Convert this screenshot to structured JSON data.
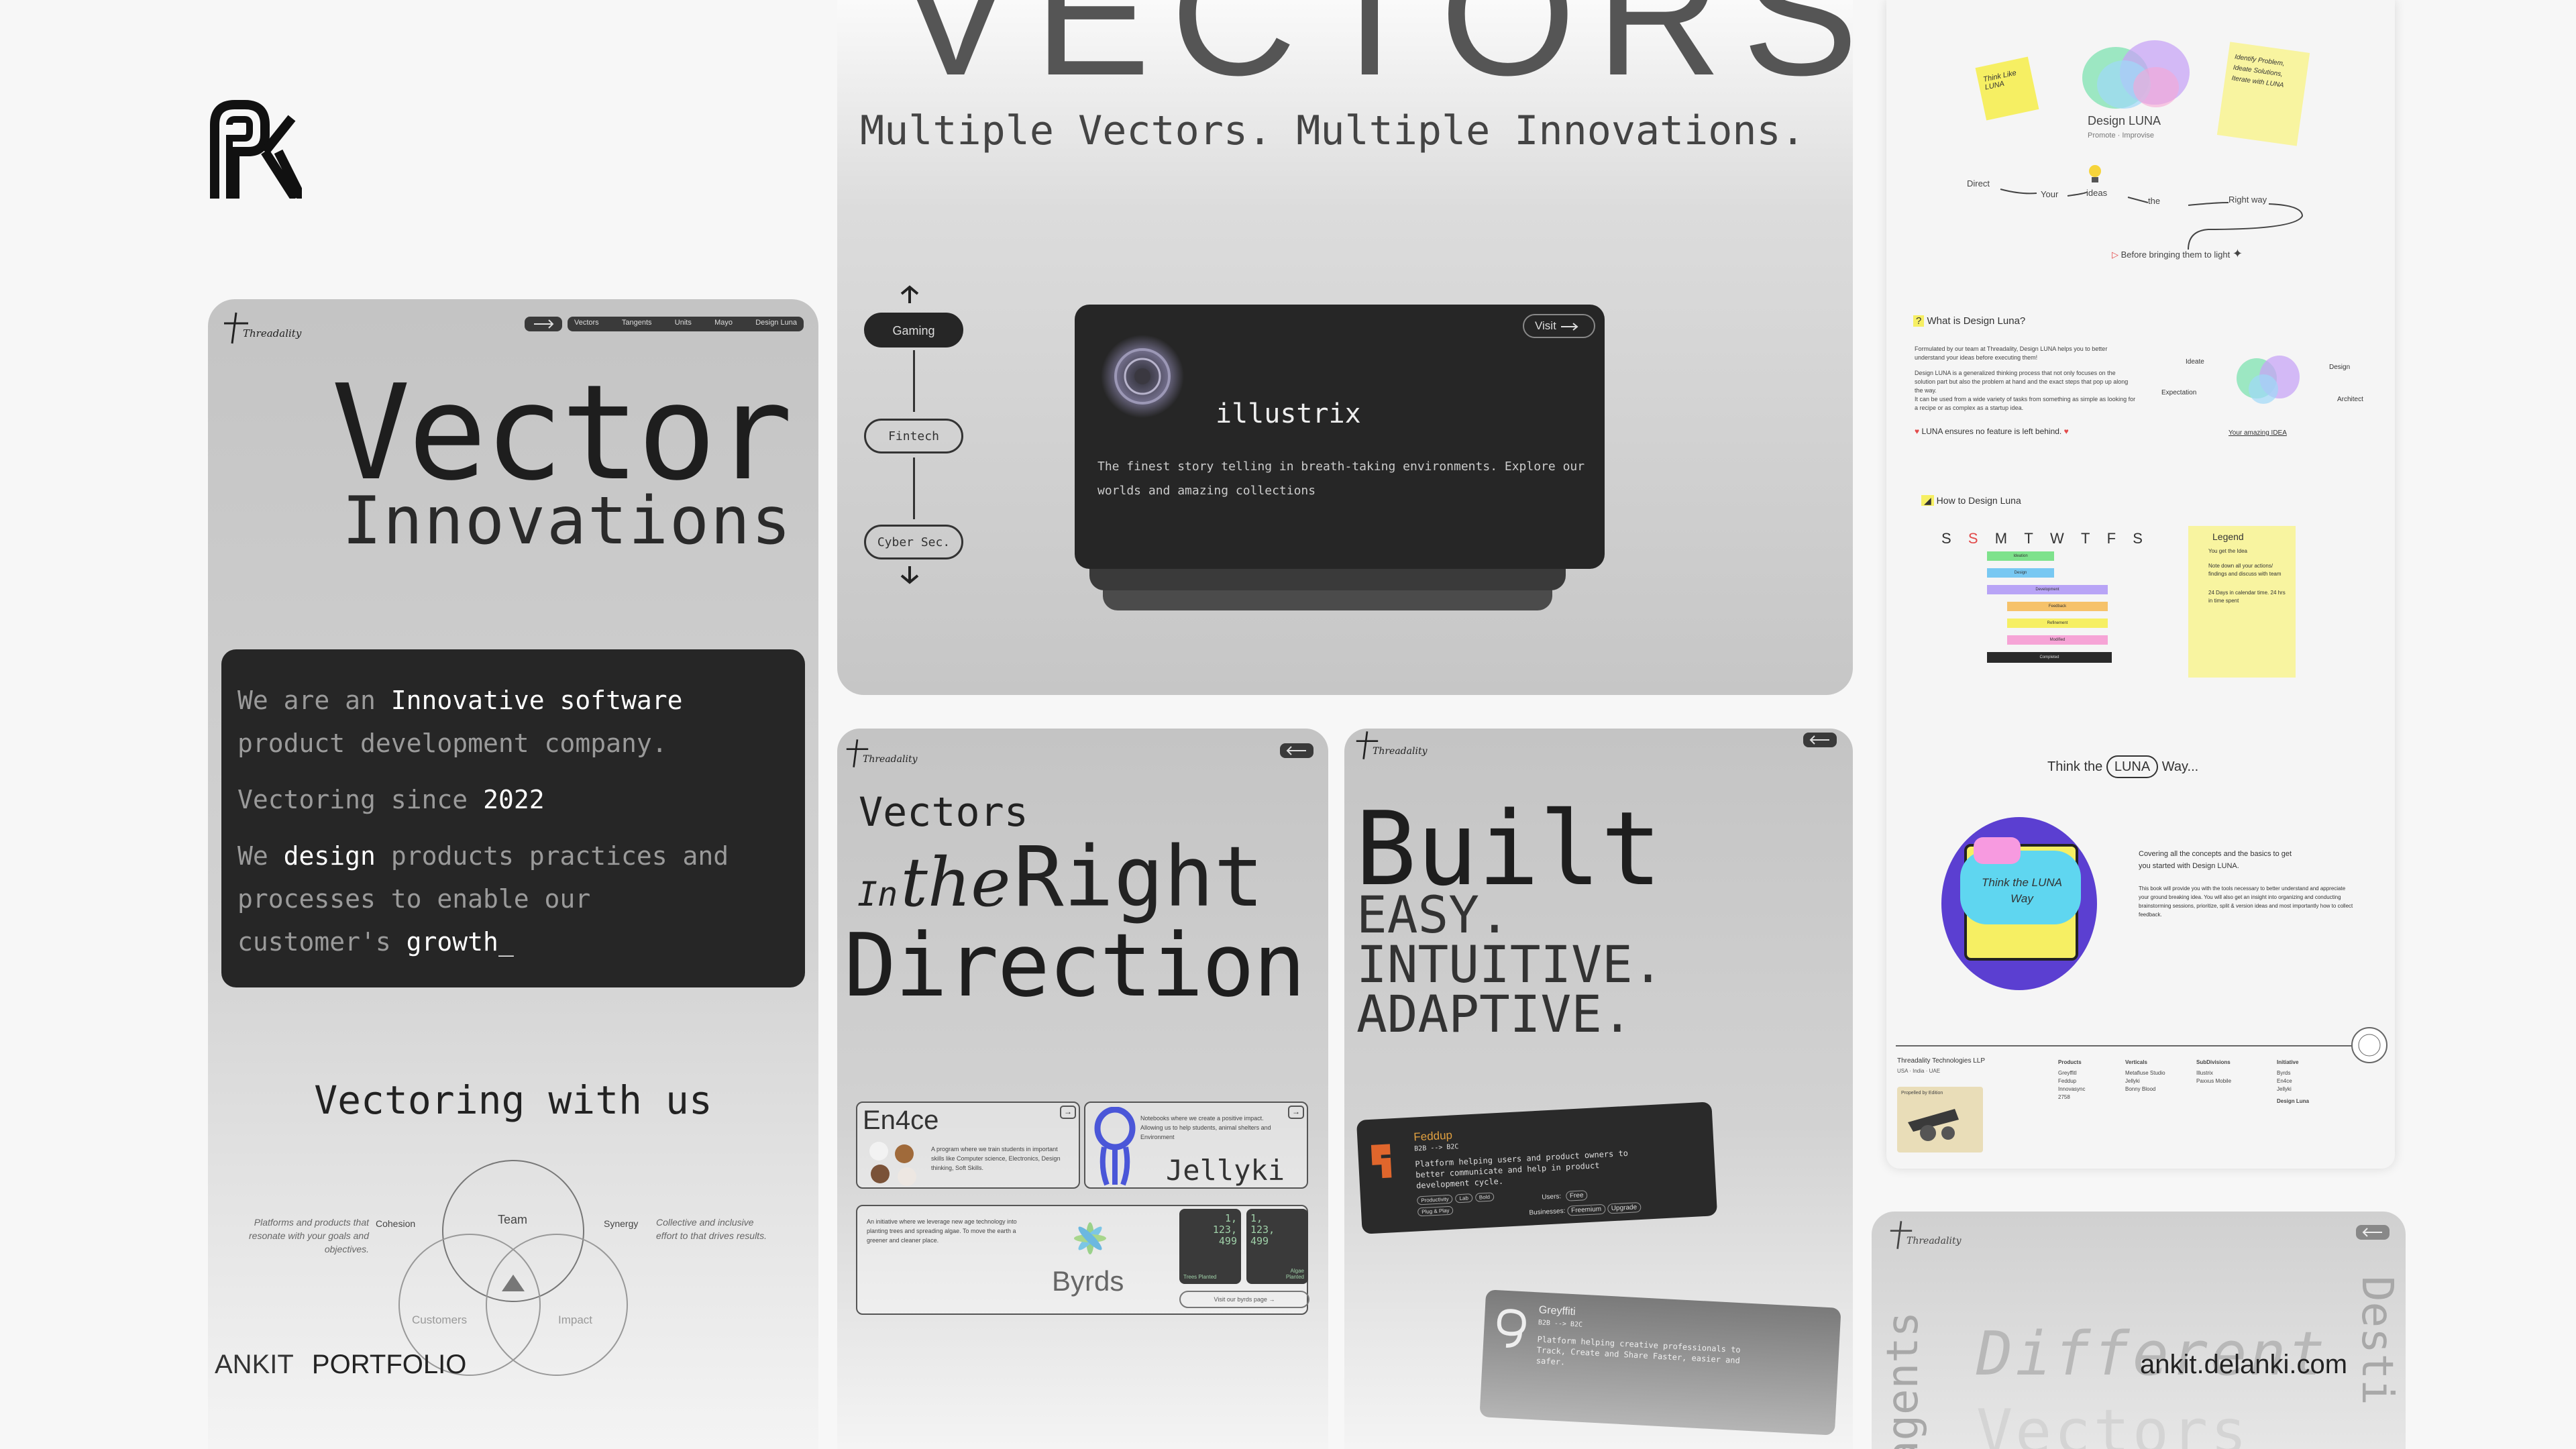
{
  "brand": {
    "logo_alt": "AK",
    "name": "ANKIT",
    "portfolio": "PORTFOLIO",
    "site": "ankit.delanki.com"
  },
  "card_main": {
    "logo": "Threadality",
    "nav": [
      "Vectors",
      "Tangents",
      "Units",
      "Mayo",
      "Design Luna"
    ],
    "title": "Vector",
    "subtitle": "Innovations",
    "about": {
      "l1a": "We are an",
      "l1b": "Innovative software",
      "l2": "product development company.",
      "l3a": "Vectoring since",
      "l3b": "2022",
      "l4a": "We",
      "l4b": "design",
      "l4c": "products practices and",
      "l5": "processes to enable our",
      "l6a": "customer's",
      "l6b": "growth_"
    },
    "vectoring": "Vectoring with us",
    "venn": {
      "team": "Team",
      "customers": "Customers",
      "impact": "Impact",
      "cohesion": "Cohesion",
      "synergy": "Synergy",
      "left_text": "Platforms and products that resonate with your goals and objectives.",
      "right_text": "Collective and inclusive effort to that drives results."
    }
  },
  "card_vectors": {
    "big": "VECTORS",
    "tagline": "Multiple Vectors. Multiple Innovations.",
    "nodes": [
      "Gaming",
      "Fintech",
      "Cyber Sec."
    ],
    "project": {
      "visit": "Visit",
      "name": "illustrix",
      "desc": "The finest story telling in breath-taking environments. Explore our worlds and amazing collections"
    }
  },
  "card_direction": {
    "logo": "Threadality",
    "l1": "Vectors",
    "l2a": "In",
    "l2b": "the",
    "l2c": "Right",
    "l3": "Direction",
    "en4ce": {
      "title": "En4ce",
      "desc": "A program where we train students in important skills like Computer science, Electronics, Design thinking, Soft Skills."
    },
    "jellyki": {
      "title": "Jellyki",
      "desc": "Notebooks where we create a positive impact. Allowing us to help students, animal shelters and Environment"
    },
    "byrds": {
      "title": "Byrds",
      "desc": "An initiative where we leverage new age technology into planting trees and spreading algae. To move the earth a greener and cleaner place.",
      "stat1": "1, 123, 499",
      "stat1_label": "Trees Planted",
      "stat2": "1, 123, 499",
      "stat2_label": "Algae Planted",
      "cta": "Visit our byrds page"
    }
  },
  "card_built": {
    "logo": "Threadality",
    "title": "Built",
    "l1": "EASY.",
    "l2": "INTUITIVE.",
    "l3": "ADAPTIVE.",
    "feddup": {
      "name": "Feddup",
      "type": "B2B --> B2C",
      "desc": "Platform helping users and product owners to better communicate and help in product development cycle.",
      "tags": [
        "Productivity",
        "Lab",
        "Bold",
        "Plug & Play"
      ],
      "users_label": "Users:",
      "users": "Free",
      "biz_label": "Businesses:",
      "biz": [
        "Freemium",
        "Upgrade"
      ]
    },
    "greyffiti": {
      "name": "Greyffiti",
      "type": "B2B --> B2C",
      "desc": "Platform helping creative professionals to Track, Create and Share Faster, easier and safer."
    }
  },
  "card_luna": {
    "sticky1": "Think Like LUNA",
    "sticky2": "Identify Problem, Ideate Solutions, Iterate with LUNA",
    "design_luna": "Design LUNA",
    "design_luna_sub": "Promote · Improvise",
    "flow": [
      "Direct",
      "Your",
      "ideas",
      "the",
      "Right way"
    ],
    "flow_end": "Before bringing them to light",
    "what_title": "What is Design Luna?",
    "what_p1": "Formulated by our team at Threadality, Design LUNA helps you to better understand your ideas before executing them!",
    "what_p2": "Design LUNA is a generalized thinking process that not only focuses on the solution part but also the problem at hand and the exact steps that pop up along the way.",
    "what_p3": "It can be used from a wide variety of tasks from something as simple as looking for a recipe or as complex as a startup idea.",
    "luna_ensures": "LUNA ensures no feature is left behind.",
    "diagram": [
      "Ideate",
      "Design",
      "Expectation",
      "Architect",
      "Your amazing IDEA"
    ],
    "how_title": "How to Design Luna",
    "days": [
      "S",
      "S",
      "M",
      "T",
      "W",
      "T",
      "F",
      "S"
    ],
    "bars": [
      "Ideation",
      "Design",
      "Development",
      "Feedback",
      "Refinement",
      "Modified",
      "Completed"
    ],
    "legend_title": "Legend",
    "legend": [
      "You get the Idea",
      "Note down all your actions/ findings and discuss with team",
      "24 Days in calendar time. 24 hrs in time spent"
    ],
    "think": "Think the",
    "think_luna": "LUNA",
    "think_way": "Way...",
    "book_title": "Think the LUNA Way",
    "cover_l1": "Covering all the concepts and the basics to get",
    "cover_l2": "you started with Design LUNA.",
    "cover_p": "This book will provide you with the tools necessary to better understand and appreciate your ground breaking idea. You will also get an insight into organizing and conducting brainstorming sessions, prioritize, split & version ideas and most importantly how to collect feedback.",
    "footer": {
      "company": "Threadality Technologies LLP",
      "loc": "USA · India · UAE",
      "cols": [
        {
          "h": "Products",
          "items": [
            "GreyffitI",
            "Feddup",
            "Innovasync",
            "2758"
          ]
        },
        {
          "h": "Verticals",
          "items": [
            "Metafluse Studio",
            "Jellyki",
            "Bonny Blood"
          ]
        },
        {
          "h": "SubDivisions",
          "items": [
            "Illustrix",
            "Paxxus Mobile"
          ]
        },
        {
          "h": "Initiative",
          "items": [
            "Byrds",
            "En4ce",
            "Jellyki"
          ]
        }
      ],
      "design_luna": "Design Luna",
      "propelled": "Propelled by Edition"
    }
  },
  "card_diff": {
    "logo": "Threadality",
    "left": "agents",
    "center": "Different",
    "center2": "Vectors",
    "right": "Desti"
  },
  "colors": {
    "accent_green": "#8ac59a",
    "dark": "#262626",
    "violet": "#5b3fd1",
    "yellow": "#f6ef63"
  }
}
